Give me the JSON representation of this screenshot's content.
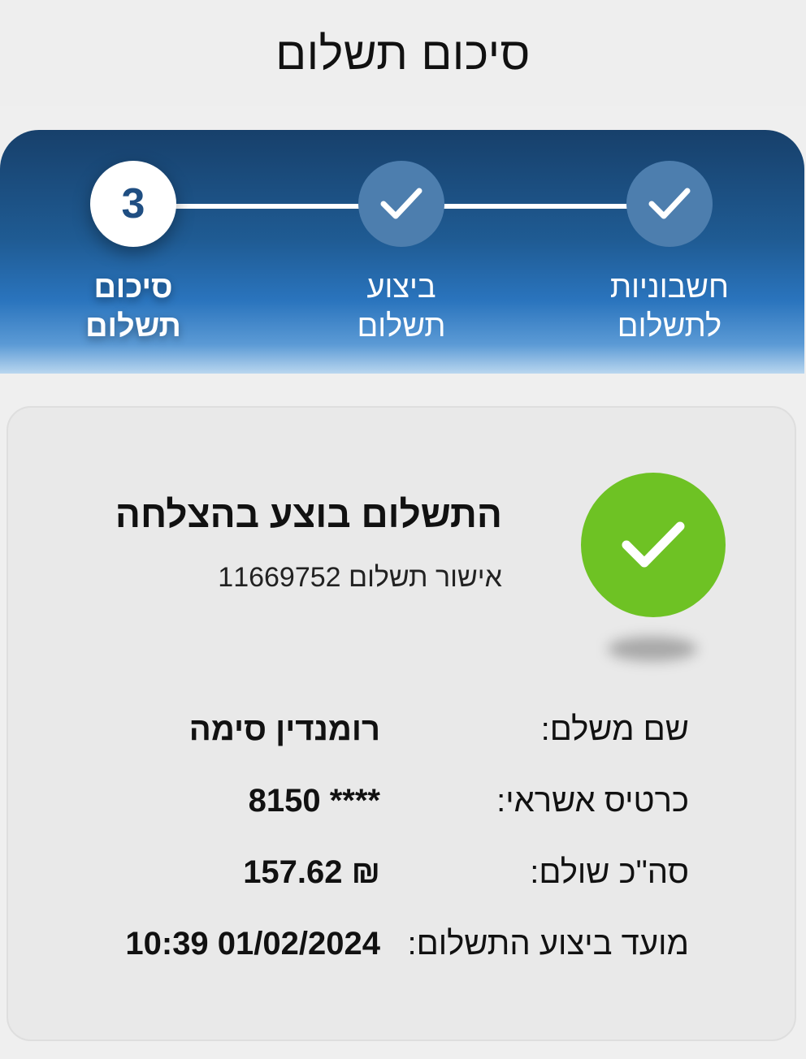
{
  "header": {
    "title": "סיכום תשלום"
  },
  "stepper": {
    "steps": [
      {
        "label_line1": "חשבוניות",
        "label_line2": "לתשלום",
        "state": "done",
        "icon": "check-icon"
      },
      {
        "label_line1": "ביצוע",
        "label_line2": "תשלום",
        "state": "done",
        "icon": "check-icon"
      },
      {
        "number": "3",
        "label_line1": "סיכום",
        "label_line2": "תשלום",
        "state": "active"
      }
    ]
  },
  "summary": {
    "title": "התשלום בוצע בהצלחה",
    "approval_label": "אישור תשלום",
    "approval_number": "11669752",
    "status_icon": "check-icon",
    "rows": [
      {
        "label": "שם משלם:",
        "value": "רומנדין סימה"
      },
      {
        "label": "כרטיס אשראי:",
        "value": "8150 ****"
      },
      {
        "label": "סה\"כ שולם:",
        "value": "157.62 ₪"
      },
      {
        "label": "מועד ביצוע התשלום:",
        "value": "10:39 01/02/2024"
      }
    ]
  },
  "colors": {
    "brand_dark": "#17406b",
    "brand_light": "#5b9ad5",
    "success": "#6ec224",
    "step_done": "#4d7eae"
  }
}
